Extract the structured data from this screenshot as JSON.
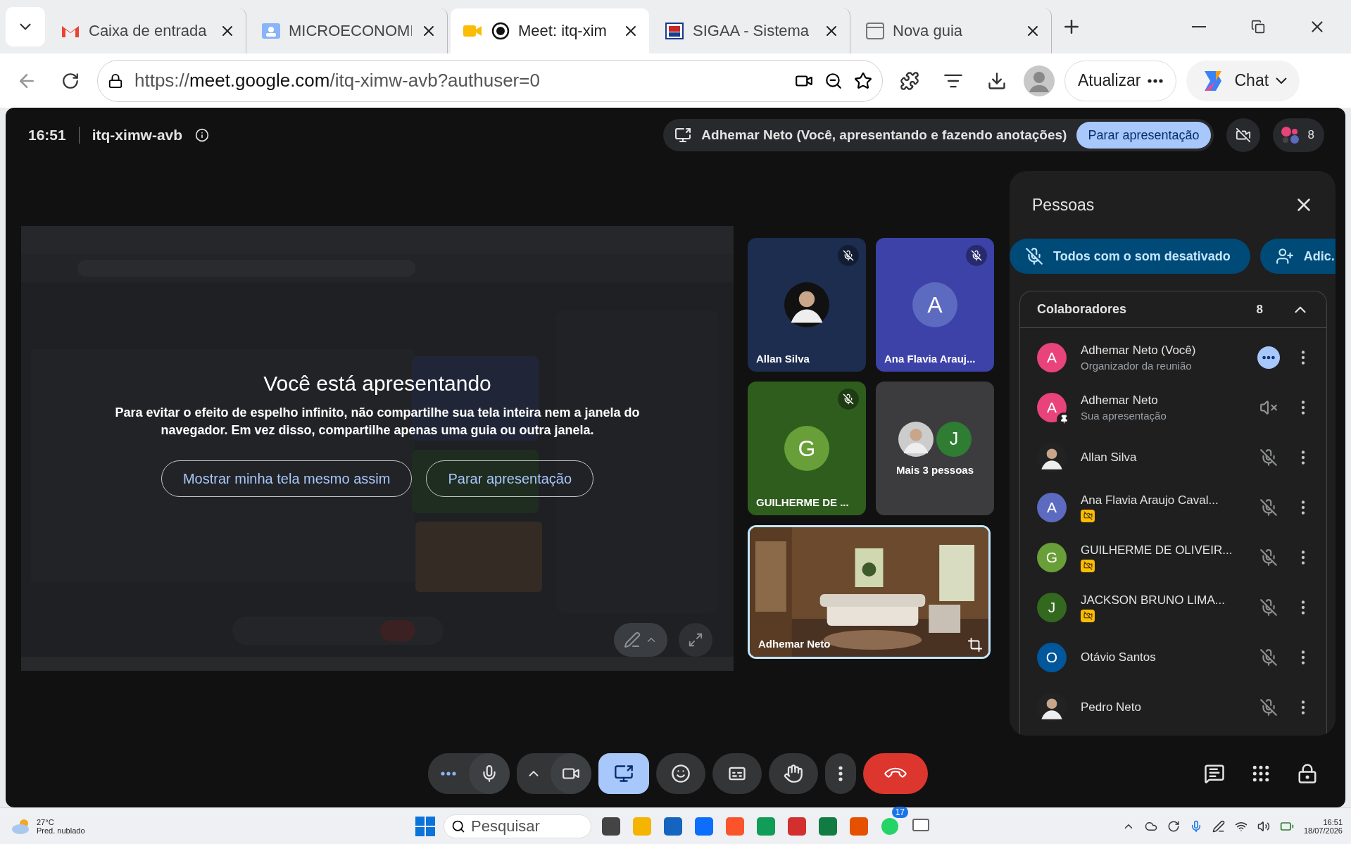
{
  "browser": {
    "tabs": [
      {
        "title": "Caixa de entrada",
        "selected": false
      },
      {
        "title": "MICROECONOMI",
        "selected": false
      },
      {
        "title": "Meet: itq-xim",
        "selected": true
      },
      {
        "title": "SIGAA - Sistema",
        "selected": false
      },
      {
        "title": "Nova guia",
        "selected": false
      }
    ],
    "url": {
      "scheme": "https://",
      "host": "meet.google.com",
      "path": "/itq-ximw-avb?authuser=0"
    },
    "update_button": "Atualizar",
    "chat_button": "Chat"
  },
  "meet": {
    "time": "16:51",
    "code": "itq-ximw-avb",
    "presenting_banner": "Adhemar Neto (Você, apresentando e fazendo anotações)",
    "stop_button": "Parar apresentação",
    "participant_count": "8",
    "overlay": {
      "title": "Você está apresentando",
      "message": "Para evitar o efeito de espelho infinito, não compartilhe sua tela inteira nem a janela do navegador. Em vez disso, compartilhe apenas uma guia ou outra janela.",
      "buttons": [
        "Mostrar minha tela mesmo assim",
        "Parar apresentação"
      ]
    },
    "tiles": [
      {
        "name": "Allan Silva",
        "muted": true,
        "color": "#1d2d4f"
      },
      {
        "name": "Ana Flavia Arauj...",
        "kind": "letter",
        "letter": "A",
        "muted": true,
        "color": "#3c42a8"
      },
      {
        "name": "GUILHERME DE ...",
        "kind": "letter",
        "letter": "G",
        "muted": true,
        "color": "#2f5d1e"
      },
      {
        "name": "Mais 3 pessoas",
        "kind": "more",
        "letter": "J",
        "muted": false,
        "color": "#3c3c3f"
      },
      {
        "name": "Adhemar Neto",
        "kind": "self",
        "muted": false,
        "color": "#222222"
      }
    ],
    "people": {
      "title": "Pessoas",
      "mute_all": "Todos com o som desativado",
      "add": "Adic.",
      "section": "Colaboradores",
      "section_count": "8",
      "expanded": true,
      "list": [
        {
          "name": "Adhemar Neto (Você)",
          "subtitle": "Organizador da reunião",
          "kind": "letter",
          "letter": "A",
          "color": "#e8437a",
          "camera_off": false,
          "muted": false,
          "pinned": false
        },
        {
          "name": "Adhemar Neto",
          "subtitle": "Sua apresentação",
          "kind": "letter",
          "letter": "A",
          "color": "#e8437a",
          "camera_off": false,
          "pinned": true
        },
        {
          "name": "Allan Silva",
          "camera_off": false,
          "muted": true,
          "pinned": false
        },
        {
          "name": "Ana Flavia Araujo Caval...",
          "kind": "letter",
          "letter": "A",
          "color": "#5c6bc0",
          "camera_off": true,
          "muted": true,
          "pinned": false
        },
        {
          "name": "GUILHERME DE OLIVEIR...",
          "kind": "letter",
          "letter": "G",
          "color": "#689f38",
          "camera_off": true,
          "muted": true,
          "pinned": false
        },
        {
          "name": "JACKSON BRUNO LIMA...",
          "kind": "letter",
          "letter": "J",
          "color": "#33691e",
          "camera_off": true,
          "muted": true,
          "pinned": false
        },
        {
          "name": "Otávio Santos",
          "kind": "letter",
          "letter": "O",
          "color": "#01579b",
          "camera_off": false,
          "muted": true,
          "pinned": false
        },
        {
          "name": "Pedro Neto",
          "camera_off": false,
          "muted": true,
          "pinned": false
        }
      ]
    },
    "controls": {
      "mic_on": true,
      "camera_on": true,
      "presenting": true
    }
  },
  "taskbar": {
    "weather_temp": "27°C",
    "weather_text": "Pred. nublado",
    "search": "Pesquisar",
    "whatsapp_badge": "17",
    "clock_time": "16:51",
    "clock_date": "18/07/2026"
  }
}
